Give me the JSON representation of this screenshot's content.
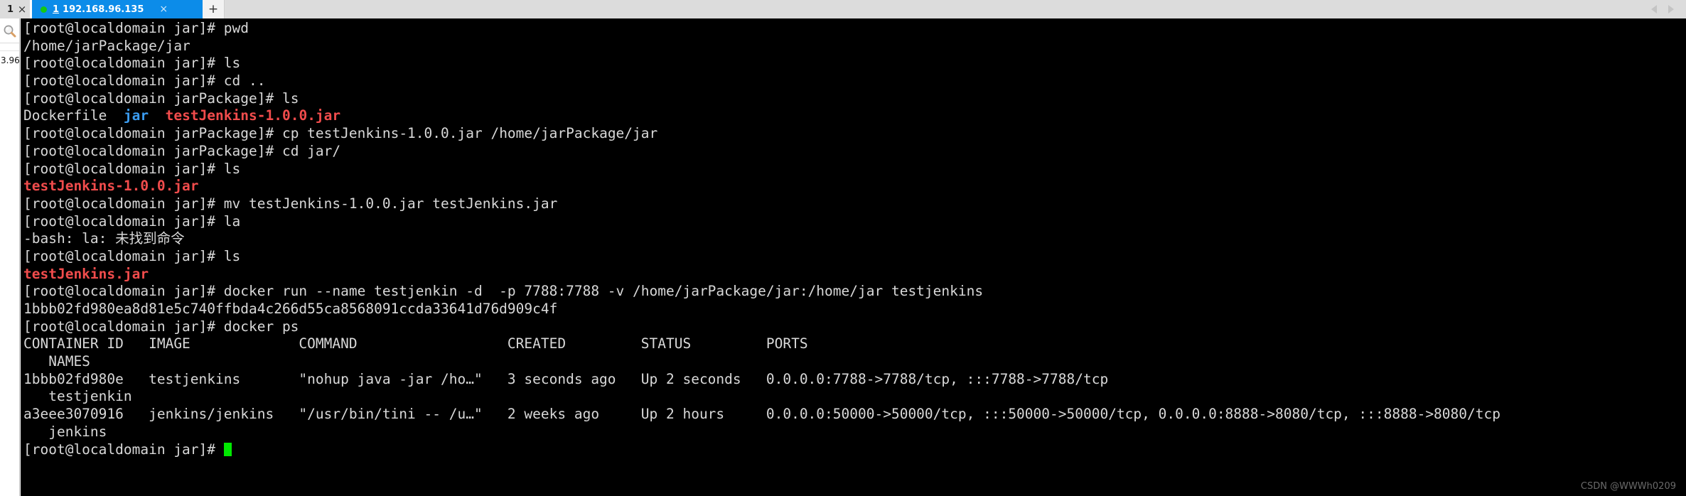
{
  "window": {
    "tabstrip": {
      "partial_tab_label": "1",
      "partial_tab_close": "×",
      "active_tab": {
        "status_dot": "green-dot-icon",
        "index": "1",
        "title": "192.168.96.135",
        "close": "×"
      },
      "new_tab_label": "+",
      "scroll_left": "◀",
      "scroll_right": "▶"
    },
    "sidebar": {
      "search_icon": "magnifier-icon",
      "entry_label": "3.96."
    },
    "watermark": "CSDN @WWWh0209"
  },
  "terminal": {
    "prompt_jar": "[root@localdomain jar]# ",
    "prompt_jarpackage": "[root@localdomain jarPackage]# ",
    "lines": [
      {
        "id": "l01",
        "type": "prompt",
        "prompt": "[root@localdomain jar]# ",
        "command": "pwd"
      },
      {
        "id": "l02",
        "type": "output",
        "text": "/home/jarPackage/jar"
      },
      {
        "id": "l03",
        "type": "prompt",
        "prompt": "[root@localdomain jar]# ",
        "command": "ls"
      },
      {
        "id": "l04",
        "type": "prompt",
        "prompt": "[root@localdomain jar]# ",
        "command": "cd .."
      },
      {
        "id": "l05",
        "type": "prompt",
        "prompt": "[root@localdomain jarPackage]# ",
        "command": "ls"
      },
      {
        "id": "l06",
        "type": "ls-colored",
        "parts": [
          {
            "text": "Dockerfile",
            "color": "white"
          },
          {
            "text": "  ",
            "color": "white"
          },
          {
            "text": "jar",
            "color": "blue"
          },
          {
            "text": "  ",
            "color": "white"
          },
          {
            "text": "testJenkins-1.0.0.jar",
            "color": "red"
          }
        ]
      },
      {
        "id": "l07",
        "type": "prompt",
        "prompt": "[root@localdomain jarPackage]# ",
        "command": "cp testJenkins-1.0.0.jar /home/jarPackage/jar"
      },
      {
        "id": "l08",
        "type": "prompt",
        "prompt": "[root@localdomain jarPackage]# ",
        "command": "cd jar/"
      },
      {
        "id": "l09",
        "type": "prompt",
        "prompt": "[root@localdomain jar]# ",
        "command": "ls"
      },
      {
        "id": "l10",
        "type": "ls-colored",
        "parts": [
          {
            "text": "testJenkins-1.0.0.jar",
            "color": "red"
          }
        ]
      },
      {
        "id": "l11",
        "type": "prompt",
        "prompt": "[root@localdomain jar]# ",
        "command": "mv testJenkins-1.0.0.jar testJenkins.jar"
      },
      {
        "id": "l12",
        "type": "prompt",
        "prompt": "[root@localdomain jar]# ",
        "command": "la"
      },
      {
        "id": "l13",
        "type": "output",
        "text": "-bash: la: 未找到命令"
      },
      {
        "id": "l14",
        "type": "prompt",
        "prompt": "[root@localdomain jar]# ",
        "command": "ls"
      },
      {
        "id": "l15",
        "type": "ls-colored",
        "parts": [
          {
            "text": "testJenkins.jar",
            "color": "red"
          }
        ]
      },
      {
        "id": "l16",
        "type": "prompt",
        "prompt": "[root@localdomain jar]# ",
        "command": "docker run --name testjenkin -d  -p 7788:7788 -v /home/jarPackage/jar:/home/jar testjenkins"
      },
      {
        "id": "l17",
        "type": "output",
        "text": "1bbb02fd980ea8d81e5c740ffbda4c266d55ca8568091ccda33641d76d909c4f"
      },
      {
        "id": "l18",
        "type": "prompt",
        "prompt": "[root@localdomain jar]# ",
        "command": "docker ps"
      },
      {
        "id": "l19",
        "type": "output",
        "text": "CONTAINER ID   IMAGE             COMMAND                  CREATED         STATUS         PORTS"
      },
      {
        "id": "l20",
        "type": "output",
        "text": "   NAMES"
      },
      {
        "id": "l21",
        "type": "output",
        "text": "1bbb02fd980e   testjenkins       \"nohup java -jar /ho…\"   3 seconds ago   Up 2 seconds   0.0.0.0:7788->7788/tcp, :::7788->7788/tcp"
      },
      {
        "id": "l22",
        "type": "output",
        "text": "   testjenkin"
      },
      {
        "id": "l23",
        "type": "output",
        "text": "a3eee3070916   jenkins/jenkins   \"/usr/bin/tini -- /u…\"   2 weeks ago     Up 2 hours     0.0.0.0:50000->50000/tcp, :::50000->50000/tcp, 0.0.0.0:8888->8080/tcp, :::8888->8080/tcp"
      },
      {
        "id": "l24",
        "type": "output",
        "text": "   jenkins"
      },
      {
        "id": "l25",
        "type": "prompt-cursor",
        "prompt": "[root@localdomain jar]# "
      }
    ],
    "docker_ps_table": {
      "headers": [
        "CONTAINER ID",
        "IMAGE",
        "COMMAND",
        "CREATED",
        "STATUS",
        "PORTS",
        "NAMES"
      ],
      "rows": [
        {
          "container_id": "1bbb02fd980e",
          "image": "testjenkins",
          "command": "\"nohup java -jar /ho…\"",
          "created": "3 seconds ago",
          "status": "Up 2 seconds",
          "ports": "0.0.0.0:7788->7788/tcp, :::7788->7788/tcp",
          "names": "testjenkin"
        },
        {
          "container_id": "a3eee3070916",
          "image": "jenkins/jenkins",
          "command": "\"/usr/bin/tini -- /u…\"",
          "created": "2 weeks ago",
          "status": "Up 2 hours",
          "ports": "0.0.0.0:50000->50000/tcp, :::50000->50000/tcp, 0.0.0.0:8888->8080/tcp, :::8888->8080/tcp",
          "names": "jenkins"
        }
      ]
    },
    "colors": {
      "background": "#000000",
      "foreground": "#d8d8d8",
      "red": "#f14c4c",
      "blue": "#3b9cf0",
      "cursor": "#00e800",
      "tab_active": "#0c8ce9",
      "tab_dot": "#14c814"
    }
  }
}
